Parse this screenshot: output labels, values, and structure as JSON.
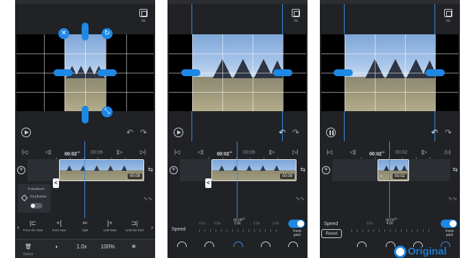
{
  "canvas": {
    "fit_label": "Fit"
  },
  "timeline": {
    "current_time": "00:02",
    "current_time_frac": "15",
    "next_time": "00:09",
    "clip_duration": "00:09",
    "clip_duration_p3": "00:02",
    "speed_time": "00:09",
    "speed_time_frac": "15",
    "speed_time_p3": "00:02",
    "speed_time_p3_frac": "10"
  },
  "transform_panel": {
    "title": "Transform",
    "keyframe_label": "Keyframe"
  },
  "tools": [
    {
      "icon": "trim-start-icon",
      "label": "From the Start"
    },
    {
      "icon": "trim-now-icon",
      "label": "From Now"
    },
    {
      "icon": "scissors-icon",
      "label": "Split"
    },
    {
      "icon": "trim-now-end-icon",
      "label": "Until Now"
    },
    {
      "icon": "trim-end-icon",
      "label": "Until the End"
    }
  ],
  "bottom_bar": {
    "delete_label": "Delete",
    "speed_value": "1.0x",
    "volume_value": "100%"
  },
  "speed_panel": {
    "label": "Speed",
    "scale_p2": [
      "0.1x",
      "0.5x",
      "1.0x",
      "1.5x",
      "2.0x"
    ],
    "scale_p2_current": "1.0x",
    "scale_p3": [
      "3.5x",
      "4.0x"
    ],
    "keep_pitch": "Keep pitch",
    "reset": "Reset"
  },
  "watermark": {
    "text": "Original"
  },
  "colors": {
    "accent": "#1e88e5",
    "background": "#202226"
  }
}
